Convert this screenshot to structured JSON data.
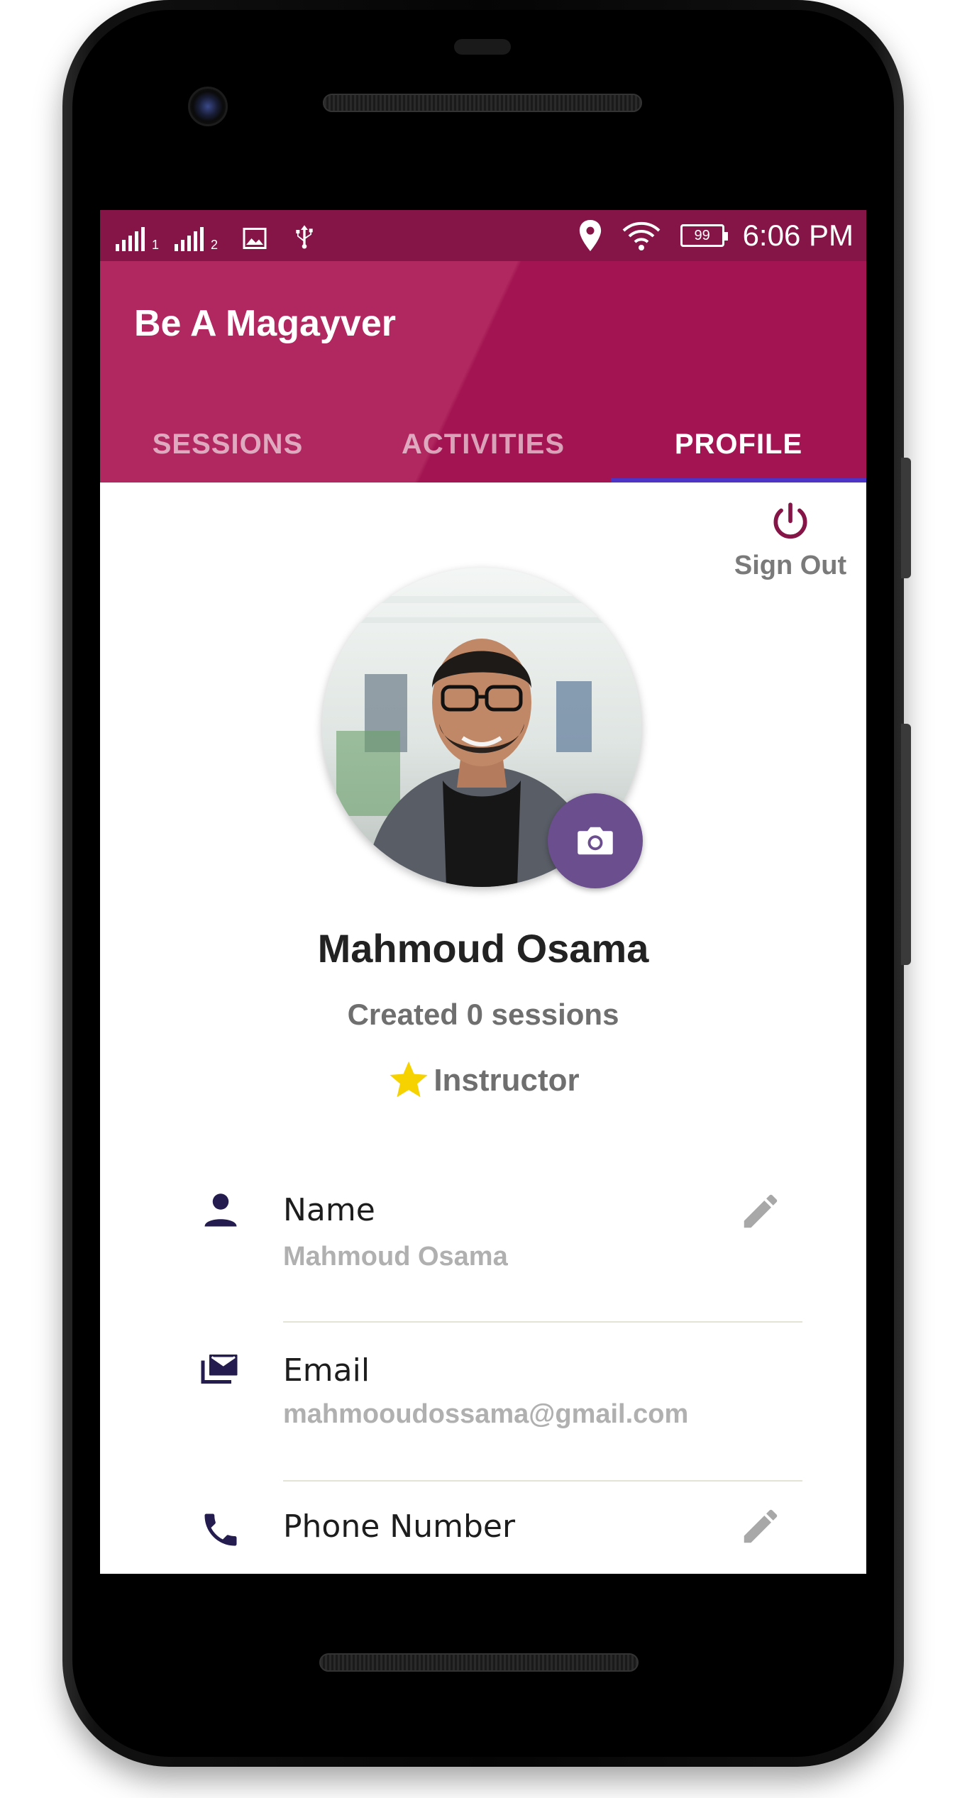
{
  "status_bar": {
    "sim1_label": "1",
    "sim2_label": "2",
    "battery_level": "99",
    "time": "6:06 PM"
  },
  "app": {
    "title": "Be A Magayver",
    "tabs": [
      {
        "label": "SESSIONS",
        "active": false
      },
      {
        "label": "ACTIVITIES",
        "active": false
      },
      {
        "label": "PROFILE",
        "active": true
      }
    ],
    "colors": {
      "status_bar": "#851546",
      "app_bar": "#a31552",
      "tab_indicator": "#4d33c6",
      "camera_button": "#6b4e8d",
      "sign_out_icon": "#851546",
      "star": "#f5d200"
    }
  },
  "profile": {
    "sign_out_label": "Sign Out",
    "name": "Mahmoud Osama",
    "sessions_text": "Created 0 sessions",
    "role": "Instructor",
    "fields": [
      {
        "icon": "person-icon",
        "label": "Name",
        "value": "Mahmoud Osama",
        "editable": true
      },
      {
        "icon": "email-icon",
        "label": "Email",
        "value": "mahmooudossama@gmail.com",
        "editable": false
      },
      {
        "icon": "phone-icon",
        "label": "Phone Number",
        "value": "",
        "editable": true
      }
    ]
  }
}
